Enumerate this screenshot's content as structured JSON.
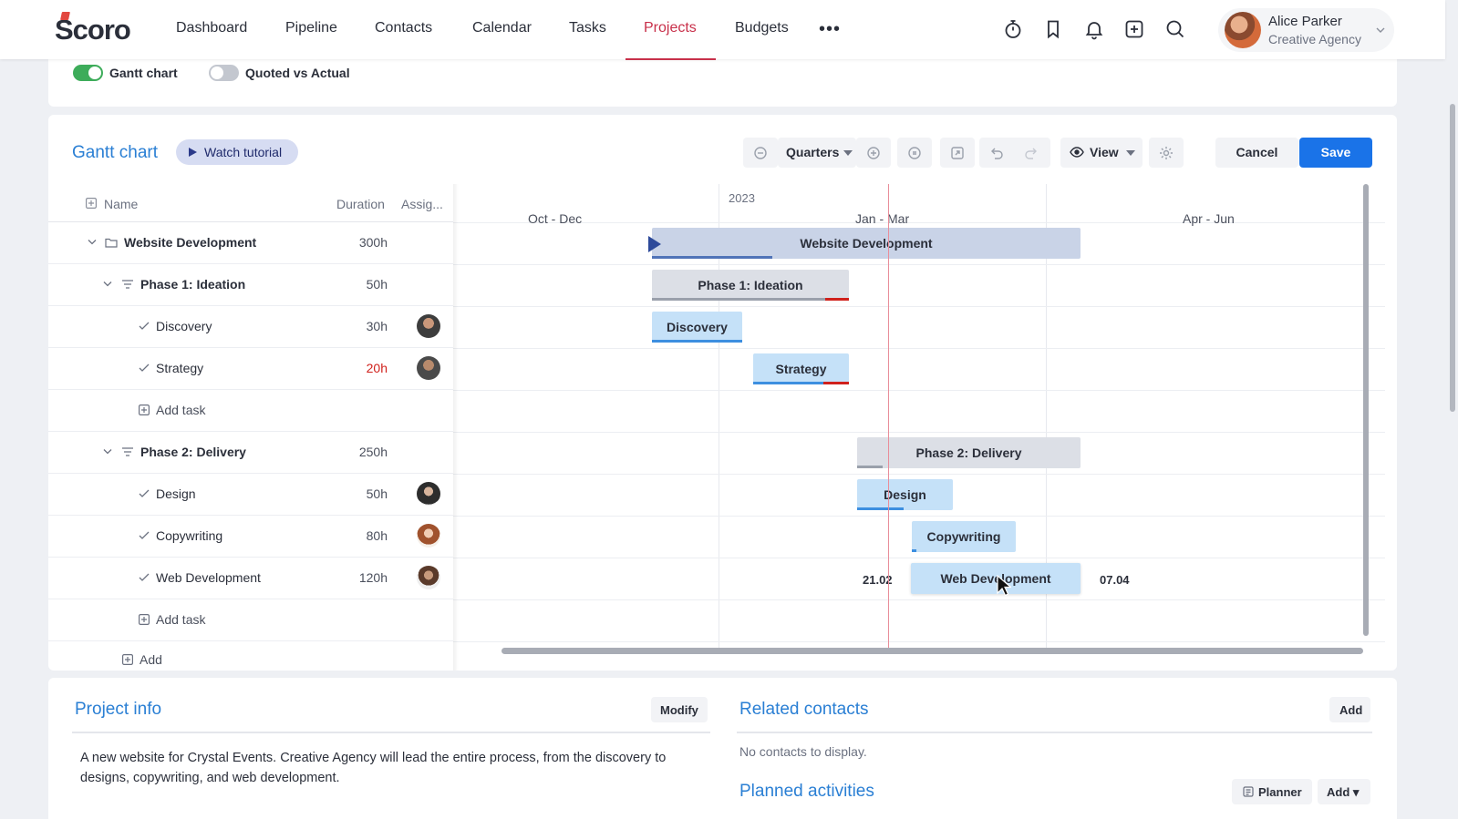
{
  "app": {
    "logo_text": "Scoro",
    "nav": [
      {
        "label": "Dashboard",
        "active": false
      },
      {
        "label": "Pipeline",
        "active": false
      },
      {
        "label": "Contacts",
        "active": false
      },
      {
        "label": "Calendar",
        "active": false
      },
      {
        "label": "Tasks",
        "active": false
      },
      {
        "label": "Projects",
        "active": true
      },
      {
        "label": "Budgets",
        "active": false
      }
    ],
    "more_label": "•••",
    "icons": [
      "timer-icon",
      "bookmark-icon",
      "bell-icon",
      "add-box-icon",
      "search-icon"
    ],
    "user": {
      "name": "Alice Parker",
      "company": "Creative Agency"
    },
    "accent_color": "#c8304a"
  },
  "toggles": [
    {
      "label": "Gantt chart",
      "on": true
    },
    {
      "label": "Quoted vs Actual",
      "on": false
    }
  ],
  "gantt": {
    "title": "Gantt chart",
    "watch_tutorial": "Watch tutorial",
    "toolbar": {
      "scale": "Quarters",
      "view": "View",
      "cancel": "Cancel",
      "save": "Save"
    },
    "columns": {
      "name": "Name",
      "duration": "Duration",
      "assignee": "Assig..."
    },
    "year": "2023",
    "quarters": [
      "Oct - Dec",
      "Jan - Mar",
      "Apr - Jun"
    ],
    "rows": [
      {
        "type": "project",
        "name": "Website Development",
        "duration": "300h",
        "bar_label": "Website Development"
      },
      {
        "type": "phase",
        "name": "Phase 1: Ideation",
        "duration": "50h",
        "bar_label": "Phase 1: Ideation"
      },
      {
        "type": "task",
        "name": "Discovery",
        "duration": "30h",
        "bar_label": "Discovery"
      },
      {
        "type": "task",
        "name": "Strategy",
        "duration": "20h",
        "over": true,
        "bar_label": "Strategy"
      },
      {
        "type": "add",
        "name": "Add task"
      },
      {
        "type": "phase",
        "name": "Phase 2: Delivery",
        "duration": "250h",
        "bar_label": "Phase 2: Delivery"
      },
      {
        "type": "task",
        "name": "Design",
        "duration": "50h",
        "bar_label": "Design"
      },
      {
        "type": "task",
        "name": "Copywriting",
        "duration": "80h",
        "bar_label": "Copywriting"
      },
      {
        "type": "task",
        "name": "Web Development",
        "duration": "120h",
        "bar_label": "Web Development"
      },
      {
        "type": "add",
        "name": "Add task"
      },
      {
        "type": "add",
        "name": "Add"
      }
    ],
    "drag_dates": {
      "start": "21.02",
      "end": "07.04"
    }
  },
  "project_info": {
    "title": "Project info",
    "modify": "Modify",
    "description": "A new website for Crystal Events. Creative Agency will lead the entire process, from the discovery to designs, copywriting, and web development."
  },
  "related_contacts": {
    "title": "Related contacts",
    "add": "Add",
    "empty": "No contacts to display."
  },
  "planned_activities": {
    "title": "Planned activities",
    "planner": "Planner",
    "add": "Add ▾"
  }
}
